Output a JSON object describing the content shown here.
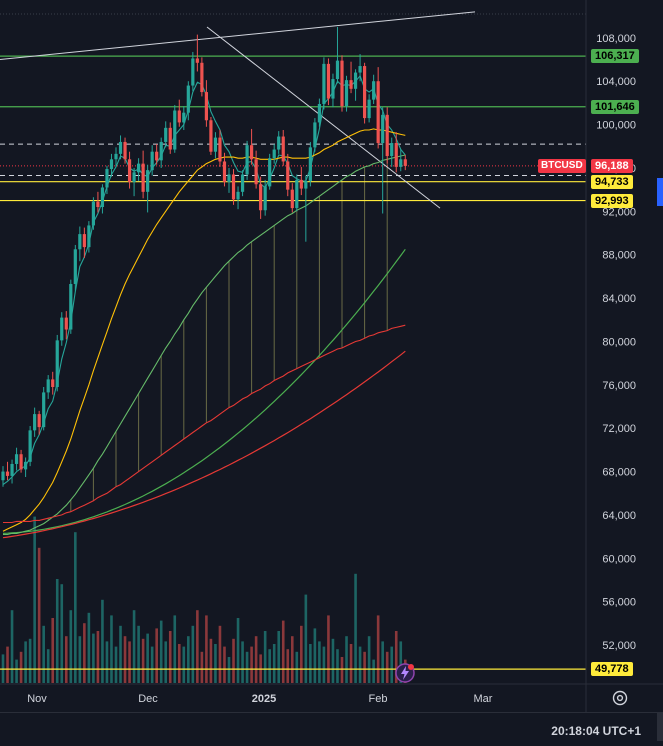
{
  "chart_data": {
    "type": "candlestick",
    "symbol": "BTCUSD",
    "last_price": "96,188",
    "x_labels": [
      "Nov",
      "Dec",
      "2025",
      "Feb",
      "Mar"
    ],
    "y_ticks": [
      108000,
      104000,
      100000,
      96000,
      92000,
      88000,
      84000,
      80000,
      76000,
      72000,
      68000,
      64000,
      60000,
      56000,
      52000
    ],
    "y_tick_labels": [
      "108,000",
      "104,000",
      "100,000",
      "96,000",
      "92,000",
      "88,000",
      "84,000",
      "80,000",
      "76,000",
      "72,000",
      "68,000",
      "64,000",
      "60,000",
      "56,000",
      "52,000"
    ],
    "ylim": [
      48500,
      110200
    ],
    "horizontal_levels": [
      {
        "label": "106,317",
        "value": 106317,
        "color": "#4caf50",
        "label_bg": "#4caf50",
        "label_fg": "#000000"
      },
      {
        "label": "101,646",
        "value": 101646,
        "color": "#4caf50",
        "label_bg": "#4caf50",
        "label_fg": "#000000"
      },
      {
        "label": "94,733",
        "value": 94733,
        "color": "#ffeb3b",
        "label_bg": "#ffeb3b",
        "label_fg": "#000000"
      },
      {
        "label": "92,993",
        "value": 92993,
        "color": "#ffeb3b",
        "label_bg": "#ffeb3b",
        "label_fg": "#000000"
      },
      {
        "label": "49,778",
        "value": 49778,
        "color": "#ffeb3b",
        "label_bg": "#ffeb3b",
        "label_fg": "#000000"
      }
    ],
    "dashed_levels": [
      98200,
      95300
    ],
    "current_price_label": {
      "symbol": "BTCUSD",
      "price": "96,188",
      "value": 96188,
      "color": "#f23645"
    },
    "candles": [
      [
        67200,
        68500,
        66600,
        68000
      ],
      [
        68000,
        68900,
        67200,
        67600
      ],
      [
        67600,
        69100,
        66900,
        68700
      ],
      [
        68700,
        70200,
        68100,
        69600
      ],
      [
        69600,
        70000,
        67900,
        68200
      ],
      [
        68200,
        69300,
        67500,
        68900
      ],
      [
        68900,
        72200,
        68500,
        71800
      ],
      [
        71800,
        73900,
        71200,
        73300
      ],
      [
        73300,
        73600,
        71400,
        72100
      ],
      [
        72100,
        75800,
        71800,
        75300
      ],
      [
        75300,
        76900,
        74700,
        76500
      ],
      [
        76500,
        77200,
        75100,
        75800
      ],
      [
        75800,
        80600,
        75400,
        80100
      ],
      [
        80100,
        82700,
        79600,
        82200
      ],
      [
        82200,
        82800,
        80200,
        81100
      ],
      [
        81100,
        85700,
        80700,
        85300
      ],
      [
        85300,
        88900,
        84700,
        88500
      ],
      [
        88500,
        90600,
        87400,
        89900
      ],
      [
        89900,
        90500,
        87700,
        88700
      ],
      [
        88700,
        91100,
        88200,
        90700
      ],
      [
        90700,
        93300,
        90300,
        92900
      ],
      [
        92900,
        93800,
        91900,
        92400
      ],
      [
        92400,
        94500,
        91800,
        94200
      ],
      [
        94200,
        96200,
        93600,
        95900
      ],
      [
        95900,
        97300,
        95200,
        96800
      ],
      [
        96800,
        97900,
        96100,
        97300
      ],
      [
        97300,
        99000,
        96800,
        98400
      ],
      [
        98400,
        98800,
        96400,
        96800
      ],
      [
        96800,
        97500,
        94100,
        94700
      ],
      [
        94700,
        96000,
        93400,
        95600
      ],
      [
        95600,
        96900,
        94800,
        96400
      ],
      [
        96400,
        97600,
        93200,
        93800
      ],
      [
        93800,
        96300,
        91900,
        95800
      ],
      [
        95800,
        98100,
        95300,
        97500
      ],
      [
        97500,
        98200,
        96300,
        96700
      ],
      [
        96700,
        98800,
        96000,
        98400
      ],
      [
        98400,
        100300,
        97900,
        99700
      ],
      [
        99700,
        100200,
        97300,
        97700
      ],
      [
        97700,
        101800,
        97400,
        101300
      ],
      [
        101300,
        102300,
        99800,
        100200
      ],
      [
        100200,
        101700,
        99500,
        101100
      ],
      [
        101100,
        104000,
        100400,
        103600
      ],
      [
        103600,
        106700,
        103100,
        106100
      ],
      [
        106100,
        108300,
        104900,
        105700
      ],
      [
        105700,
        106200,
        102600,
        103000
      ],
      [
        103000,
        104100,
        99800,
        100400
      ],
      [
        100400,
        100700,
        97200,
        97500
      ],
      [
        97500,
        99300,
        96900,
        98800
      ],
      [
        98800,
        99500,
        96100,
        96600
      ],
      [
        96600,
        97400,
        94300,
        94700
      ],
      [
        94700,
        96000,
        93700,
        95400
      ],
      [
        95400,
        95900,
        92600,
        93100
      ],
      [
        93100,
        94300,
        92200,
        93800
      ],
      [
        93800,
        95800,
        93400,
        95400
      ],
      [
        95400,
        98500,
        94900,
        98100
      ],
      [
        98100,
        99600,
        96300,
        96800
      ],
      [
        96800,
        97600,
        94100,
        94500
      ],
      [
        94500,
        95200,
        91300,
        92100
      ],
      [
        92100,
        94900,
        91600,
        94300
      ],
      [
        94300,
        97300,
        94000,
        96900
      ],
      [
        96900,
        98200,
        96400,
        97700
      ],
      [
        97700,
        99400,
        97300,
        98900
      ],
      [
        98900,
        99500,
        96200,
        96600
      ],
      [
        96600,
        97300,
        93400,
        94000
      ],
      [
        94000,
        94600,
        91900,
        92300
      ],
      [
        92300,
        95400,
        92000,
        94900
      ],
      [
        94900,
        96100,
        93500,
        94100
      ],
      [
        94100,
        95300,
        89200,
        94800
      ],
      [
        94800,
        98400,
        94300,
        97900
      ],
      [
        97900,
        100600,
        97500,
        100200
      ],
      [
        100200,
        102400,
        99800,
        101900
      ],
      [
        101900,
        106200,
        101400,
        105600
      ],
      [
        105600,
        106100,
        101800,
        102400
      ],
      [
        102400,
        104700,
        101600,
        104200
      ],
      [
        104200,
        109000,
        103800,
        105900
      ],
      [
        105900,
        106400,
        101200,
        101700
      ],
      [
        101700,
        104500,
        101200,
        104100
      ],
      [
        104100,
        105800,
        102900,
        103300
      ],
      [
        103300,
        105100,
        102200,
        104800
      ],
      [
        104800,
        106500,
        104000,
        105400
      ],
      [
        105400,
        105700,
        100100,
        100600
      ],
      [
        100600,
        102800,
        100200,
        102300
      ],
      [
        102300,
        104600,
        101900,
        104000
      ],
      [
        104000,
        105300,
        97800,
        98300
      ],
      [
        98300,
        101600,
        91800,
        100900
      ],
      [
        100900,
        101600,
        96400,
        97100
      ],
      [
        97100,
        98800,
        96100,
        98300
      ],
      [
        98300,
        99300,
        95600,
        96100
      ],
      [
        96100,
        97700,
        95700,
        96800
      ],
      [
        96800,
        97200,
        95800,
        96188
      ]
    ],
    "volume": [
      11,
      14,
      28,
      9,
      12,
      16,
      17,
      64,
      52,
      22,
      13,
      25,
      40,
      38,
      18,
      28,
      58,
      18,
      23,
      27,
      19,
      20,
      32,
      16,
      26,
      14,
      22,
      18,
      16,
      28,
      22,
      17,
      19,
      14,
      21,
      24,
      16,
      20,
      26,
      15,
      14,
      18,
      22,
      28,
      12,
      26,
      17,
      15,
      22,
      14,
      10,
      17,
      25,
      16,
      12,
      14,
      18,
      11,
      20,
      13,
      15,
      20,
      24,
      13,
      18,
      12,
      22,
      34,
      15,
      21,
      16,
      14,
      26,
      17,
      13,
      10,
      18,
      15,
      42,
      14,
      12,
      18,
      9,
      26,
      16,
      12,
      14,
      20,
      16,
      9
    ],
    "ma_lines": [
      {
        "name": "",
        "color": "#26a69a",
        "values": [
          66800,
          67100,
          67500,
          68000,
          68300,
          68500,
          69300,
          70600,
          71400,
          72500,
          73800,
          74500,
          76200,
          78400,
          79900,
          81800,
          84600,
          86900,
          87800,
          89000,
          91000,
          91800,
          92900,
          94300,
          95400,
          96100,
          97100,
          96900,
          96000,
          95700,
          95900,
          95400,
          95200,
          96000,
          96500,
          97100,
          98100,
          98000,
          99000,
          99500,
          100000,
          101300,
          103000,
          103900,
          103700,
          102700,
          101200,
          100300,
          99500,
          98100,
          97500,
          96500,
          95700,
          95600,
          96500,
          96600,
          95900,
          94500,
          94200,
          95000,
          96000,
          97200,
          97100,
          96400,
          95300,
          95000,
          94800,
          94800,
          96000,
          97800,
          99600,
          101900,
          102400,
          103000,
          104000,
          103600,
          103700,
          103600,
          104000,
          104500,
          103300,
          103000,
          103300,
          101900,
          101300,
          100000,
          99500,
          98700,
          97700,
          97200
        ]
      },
      {
        "name": "",
        "color": "#ffc107",
        "values": [
          62500,
          62700,
          62900,
          63100,
          63300,
          63600,
          64000,
          64500,
          65000,
          65600,
          66300,
          67000,
          67900,
          68900,
          69900,
          71000,
          72300,
          73600,
          74800,
          76000,
          77300,
          78500,
          79700,
          80900,
          82100,
          83200,
          84300,
          85300,
          86200,
          87000,
          87800,
          88600,
          89400,
          90100,
          90800,
          91400,
          92000,
          92600,
          93200,
          93800,
          94300,
          94800,
          95300,
          95800,
          96100,
          96400,
          96600,
          96800,
          96900,
          97000,
          97000,
          97000,
          96900,
          96900,
          97000,
          97000,
          96900,
          96800,
          96800,
          96800,
          96800,
          96900,
          97000,
          97000,
          96900,
          96900,
          96900,
          96900,
          97000,
          97200,
          97400,
          97700,
          97900,
          98100,
          98400,
          98600,
          98800,
          99000,
          99200,
          99400,
          99500,
          99500,
          99600,
          99500,
          99500,
          99400,
          99300,
          99200,
          99100,
          99000
        ]
      },
      {
        "name": "",
        "color": "#66bb6a",
        "values": [
          62200,
          62200,
          62300,
          62300,
          62400,
          62500,
          62600,
          62800,
          63000,
          63200,
          63500,
          63800,
          64100,
          64500,
          64900,
          65400,
          65900,
          66500,
          67100,
          67700,
          68300,
          69000,
          69600,
          70300,
          71000,
          71700,
          72400,
          73100,
          73800,
          74500,
          75200,
          75900,
          76600,
          77300,
          78000,
          78700,
          79400,
          80000,
          80700,
          81300,
          82000,
          82600,
          83300,
          83900,
          84500,
          85000,
          85500,
          86000,
          86500,
          87000,
          87400,
          87800,
          88200,
          88500,
          88900,
          89200,
          89500,
          89800,
          90100,
          90400,
          90700,
          91000,
          91300,
          91600,
          91800,
          92100,
          92300,
          92500,
          92800,
          93100,
          93400,
          93700,
          94000,
          94300,
          94600,
          94900,
          95200,
          95400,
          95700,
          95900,
          96100,
          96200,
          96400,
          96500,
          96700,
          96800,
          96900,
          97000,
          97100,
          97200
        ]
      },
      {
        "name": "",
        "color": "#e53935",
        "values": [
          63300,
          63300,
          63300,
          63400,
          63400,
          63400,
          63400,
          63500,
          63500,
          63600,
          63700,
          63800,
          63900,
          64000,
          64200,
          64300,
          64500,
          64700,
          64900,
          65100,
          65300,
          65600,
          65800,
          66000,
          66300,
          66600,
          66800,
          67100,
          67400,
          67700,
          68000,
          68300,
          68600,
          68900,
          69200,
          69500,
          69800,
          70100,
          70400,
          70700,
          71000,
          71300,
          71600,
          71900,
          72200,
          72500,
          72700,
          73000,
          73300,
          73600,
          73900,
          74100,
          74400,
          74700,
          74900,
          75200,
          75400,
          75600,
          75900,
          76100,
          76400,
          76600,
          76800,
          77100,
          77300,
          77500,
          77700,
          77900,
          78100,
          78300,
          78500,
          78700,
          78900,
          79100,
          79300,
          79400,
          79600,
          79800,
          80000,
          80100,
          80300,
          80500,
          80600,
          80800,
          80900,
          81000,
          81200,
          81300,
          81400,
          81500
        ]
      }
    ],
    "time": "20:18:04",
    "timezone": "UTC+1",
    "colors": {
      "up": "#26a69a",
      "down": "#ef5350",
      "bg": "#131722",
      "grid": "#1e222d",
      "axis_text": "#d1d4dc"
    }
  }
}
